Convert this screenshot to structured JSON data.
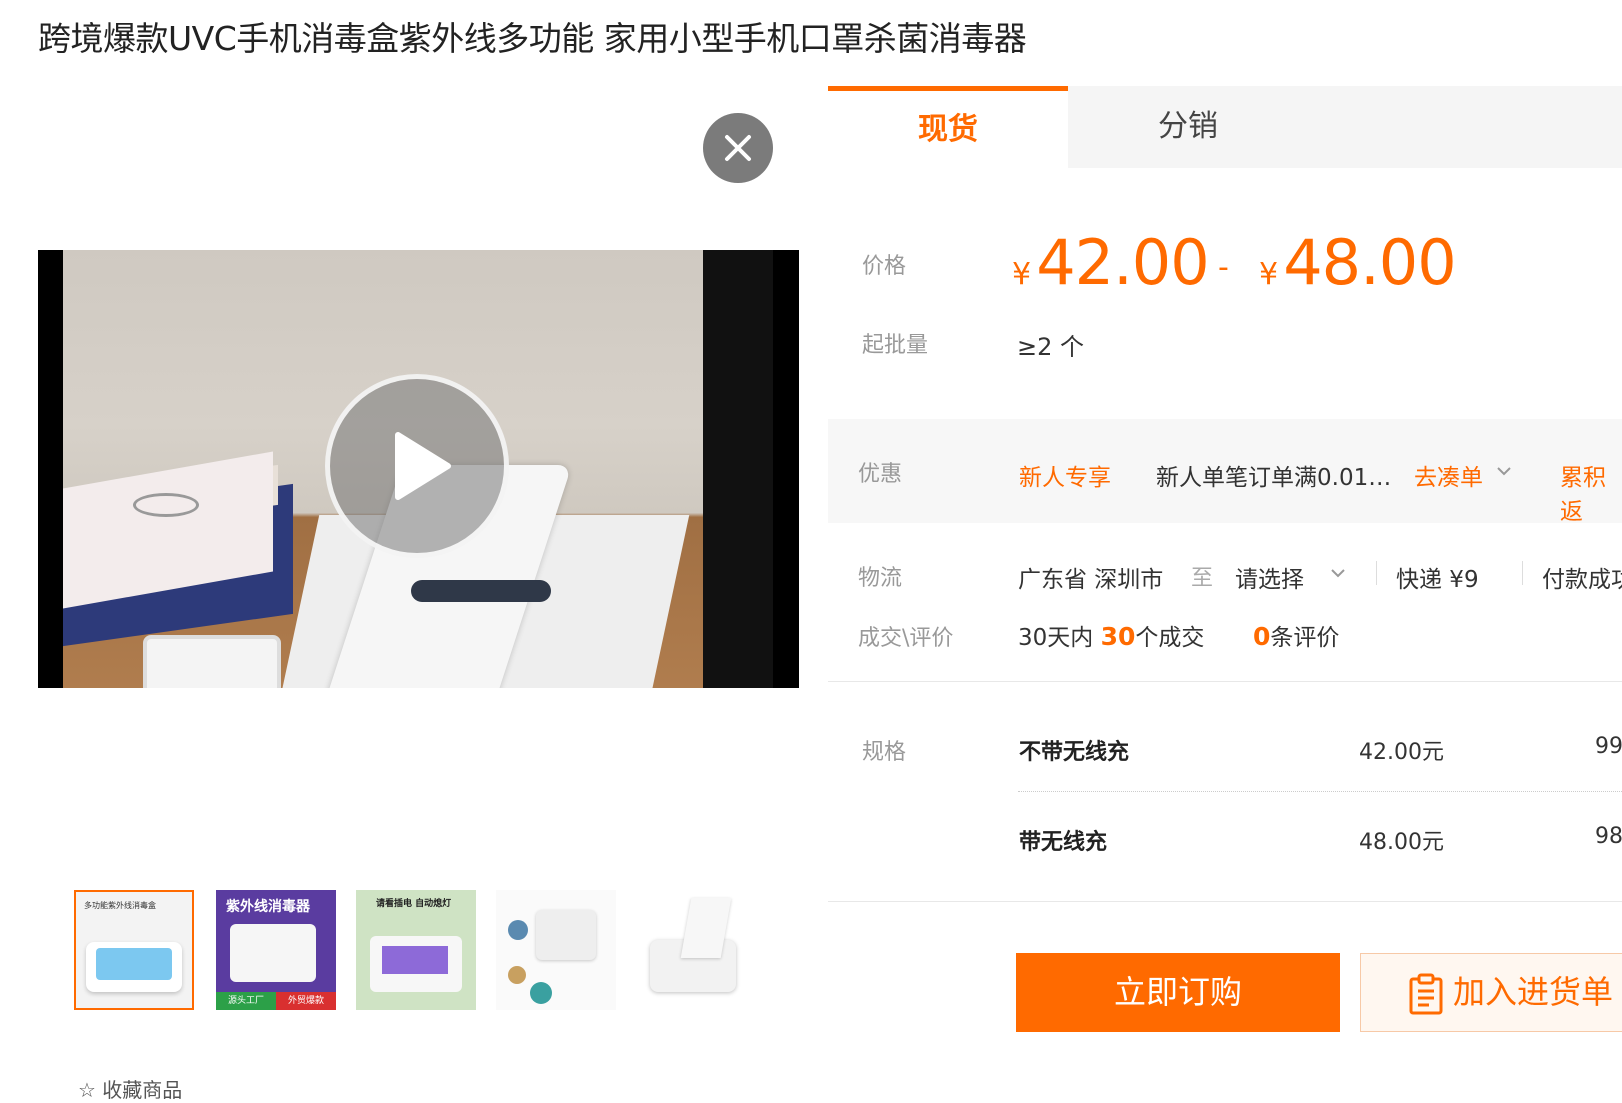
{
  "product": {
    "title": "跨境爆款UVC手机消毒盒紫外线多功能 家用小型手机口罩杀菌消毒器"
  },
  "gallery": {
    "close_icon": "close-icon",
    "play_icon": "play-icon",
    "thumb1_title": "多功能紫外线消毒盒",
    "thumb2_title": "紫外线消毒器",
    "thumb2_tag_left": "源头工厂",
    "thumb2_tag_right": "外贸爆款",
    "thumb3_title": "请看插电 自动熄灯",
    "favorite_label": "收藏商品"
  },
  "tabs": [
    {
      "label": "现货",
      "active": true
    },
    {
      "label": "分销",
      "active": false
    }
  ],
  "price": {
    "label": "价格",
    "currency": "¥",
    "low": "42.00",
    "dash": "-",
    "high": "48.00",
    "accent_color": "#ff6a00"
  },
  "moq": {
    "label": "起批量",
    "value": "≥2 个"
  },
  "promotion": {
    "label": "优惠",
    "tag": "新人专享",
    "desc": "新人单笔订单满0.01…",
    "link": "去凑单",
    "more": "累积返"
  },
  "logistics": {
    "label": "物流",
    "from": "广东省 深圳市",
    "to_word": "至",
    "select": "请选择",
    "shipping": "快递 ¥9",
    "pay": "付款成功"
  },
  "deals": {
    "label": "成交\\评价",
    "prefix": "30天内",
    "count": "30",
    "count_suffix": "个成交",
    "reviews": "0",
    "reviews_suffix": "条评价"
  },
  "specs": {
    "label": "规格",
    "rows": [
      {
        "name": "不带无线充",
        "price": "42.00元",
        "stock": "99"
      },
      {
        "name": "带无线充",
        "price": "48.00元",
        "stock": "98"
      }
    ]
  },
  "actions": {
    "buy": "立即订购",
    "cart": "加入进货单",
    "cart_icon": "clipboard-icon"
  }
}
